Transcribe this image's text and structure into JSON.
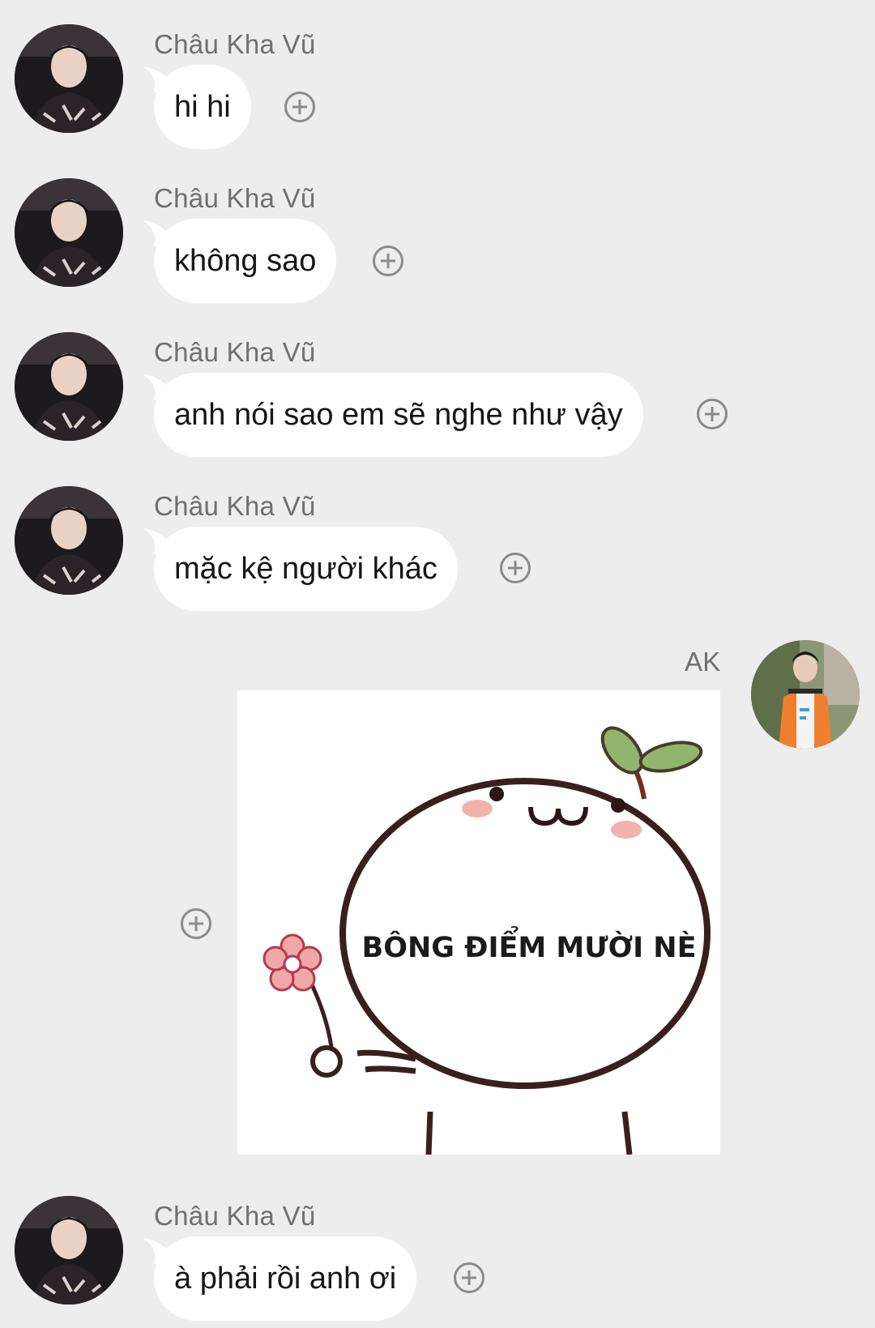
{
  "conversation": {
    "messages": [
      {
        "sender": "Châu Kha Vũ",
        "text": "hi hi"
      },
      {
        "sender": "Châu Kha Vũ",
        "text": "không sao"
      },
      {
        "sender": "Châu Kha Vũ",
        "text": "anh nói sao em sẽ nghe như vậy"
      },
      {
        "sender": "Châu Kha Vũ",
        "text": "mặc kệ người khác"
      },
      {
        "sender": "AK",
        "sticker_text": "BÔNG ĐIỂM MƯỜI NÈ"
      },
      {
        "sender": "Châu Kha Vũ",
        "text": "à phải rồi anh ơi"
      }
    ]
  },
  "icons": {
    "reaction": "plus-circle-icon",
    "avatar_left": "avatar-chau-kha-vu",
    "avatar_right": "avatar-ak"
  },
  "colors": {
    "background": "#ededed",
    "bubble": "#ffffff",
    "sender_name": "#6f6f6f",
    "message_text": "#161616",
    "plus_icon": "#8a8a8a"
  }
}
